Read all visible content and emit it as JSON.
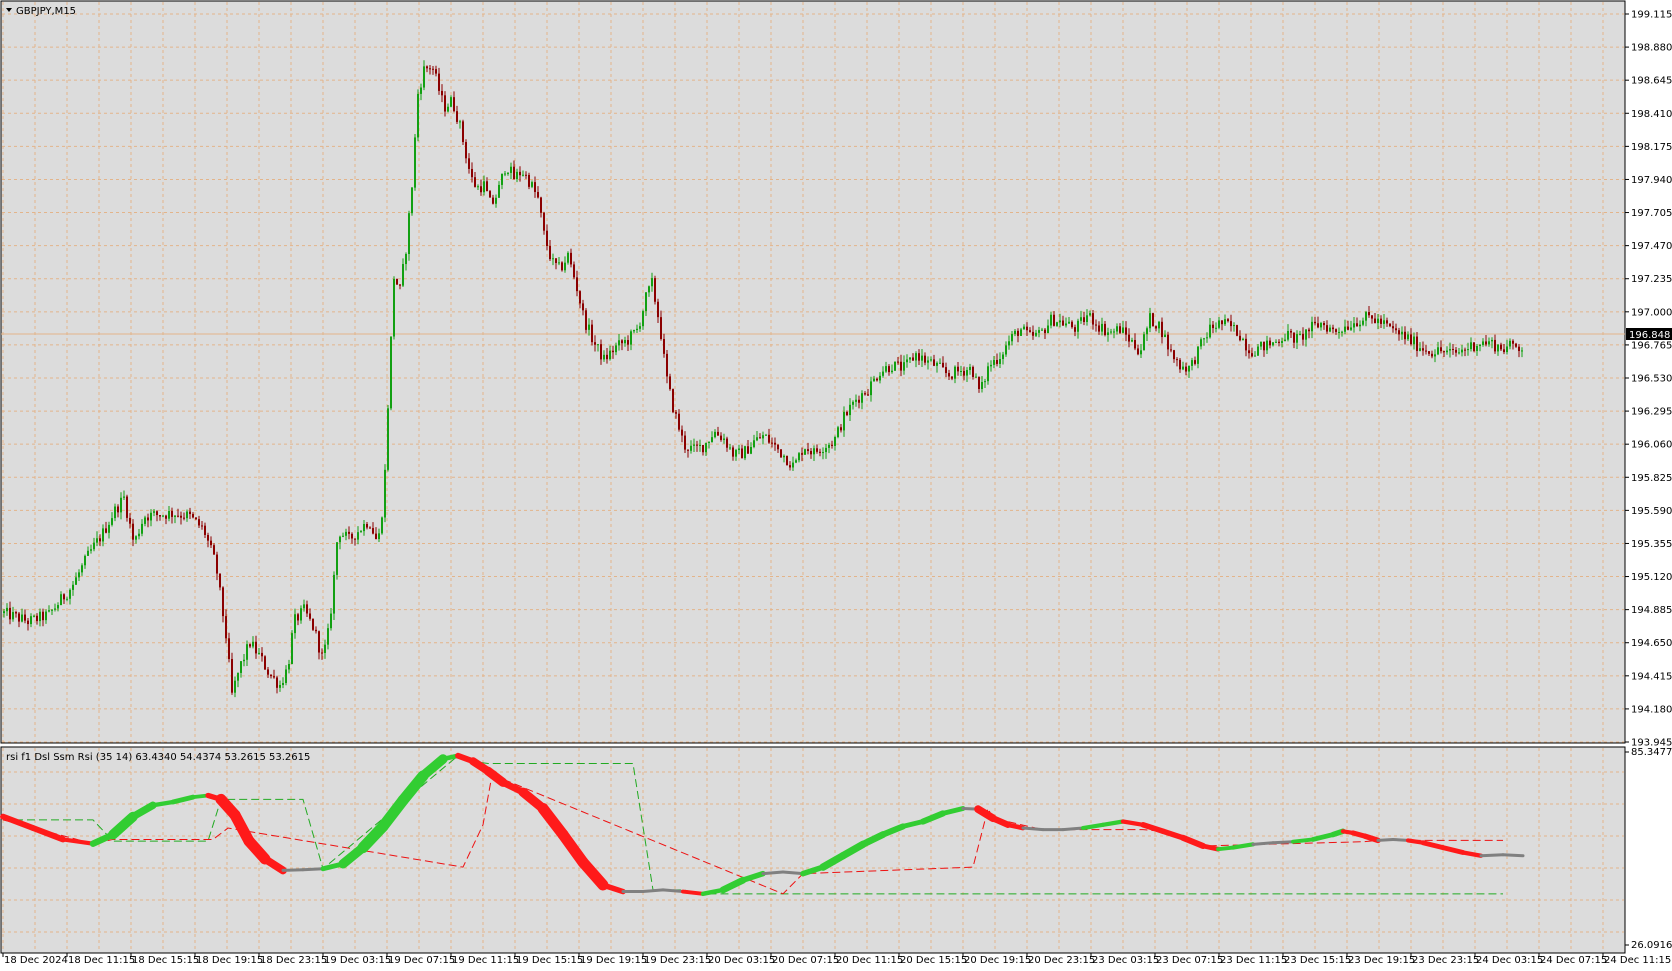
{
  "main": {
    "title": "GBPJPY,M15",
    "current_price": "196.848",
    "price_labels": [
      "199.115",
      "198.880",
      "198.645",
      "198.410",
      "198.175",
      "197.940",
      "197.705",
      "197.470",
      "197.235",
      "197.000",
      "196.765",
      "196.530",
      "196.295",
      "196.060",
      "195.825",
      "195.590",
      "195.355",
      "195.120",
      "194.885",
      "194.650",
      "194.415",
      "194.180",
      "193.945"
    ],
    "price_range": [
      193.945,
      199.115
    ],
    "current_value": 196.848
  },
  "indicator": {
    "title": "rsi f1 Dsl Ssm Rsi (35 14) 63.4340 54.4374 53.2615 53.2615",
    "top_label": "85.3477",
    "bottom_label": "26.0916",
    "range": [
      26.0916,
      85.3477
    ]
  },
  "time_labels": [
    "18 Dec 2024",
    "18 Dec 11:15",
    "18 Dec 15:15",
    "18 Dec 19:15",
    "18 Dec 23:15",
    "19 Dec 03:15",
    "19 Dec 07:15",
    "19 Dec 11:15",
    "19 Dec 15:15",
    "19 Dec 19:15",
    "19 Dec 23:15",
    "20 Dec 03:15",
    "20 Dec 07:15",
    "20 Dec 11:15",
    "20 Dec 15:15",
    "20 Dec 19:15",
    "20 Dec 23:15",
    "23 Dec 03:15",
    "23 Dec 07:15",
    "23 Dec 11:15",
    "23 Dec 15:15",
    "23 Dec 19:15",
    "23 Dec 23:15",
    "24 Dec 03:15",
    "24 Dec 07:15",
    "24 Dec 11:15"
  ],
  "colors": {
    "background": "#dcdcdc",
    "grid": "#e3b48a",
    "bull": "#12a012",
    "bear": "#8b0000",
    "rsi_up": "#32cd32",
    "rsi_down": "#ff1a1a",
    "rsi_flat": "#808080"
  },
  "chart_data": [
    {
      "type": "candlestick",
      "symbol": "GBPJPY",
      "timeframe": "M15",
      "ylim": [
        193.945,
        199.115
      ],
      "close_path": [
        [
          0,
          194.86
        ],
        [
          25,
          194.8
        ],
        [
          45,
          194.85
        ],
        [
          68,
          195.05
        ],
        [
          85,
          195.28
        ],
        [
          100,
          195.44
        ],
        [
          110,
          195.58
        ],
        [
          120,
          195.68
        ],
        [
          130,
          195.35
        ],
        [
          140,
          195.55
        ],
        [
          155,
          195.56
        ],
        [
          170,
          195.57
        ],
        [
          185,
          195.55
        ],
        [
          200,
          195.45
        ],
        [
          212,
          195.2
        ],
        [
          222,
          194.7
        ],
        [
          228,
          194.28
        ],
        [
          236,
          194.48
        ],
        [
          246,
          194.65
        ],
        [
          256,
          194.55
        ],
        [
          266,
          194.42
        ],
        [
          276,
          194.35
        ],
        [
          284,
          194.48
        ],
        [
          290,
          194.8
        ],
        [
          300,
          194.88
        ],
        [
          310,
          194.75
        ],
        [
          318,
          194.55
        ],
        [
          323,
          194.65
        ],
        [
          328,
          194.95
        ],
        [
          334,
          195.45
        ],
        [
          345,
          195.38
        ],
        [
          355,
          195.45
        ],
        [
          365,
          195.52
        ],
        [
          374,
          195.35
        ],
        [
          380,
          195.7
        ],
        [
          385,
          196.5
        ],
        [
          390,
          197.25
        ],
        [
          396,
          197.15
        ],
        [
          402,
          197.45
        ],
        [
          408,
          197.9
        ],
        [
          414,
          198.55
        ],
        [
          420,
          198.72
        ],
        [
          428,
          198.75
        ],
        [
          434,
          198.6
        ],
        [
          440,
          198.45
        ],
        [
          448,
          198.5
        ],
        [
          455,
          198.35
        ],
        [
          461,
          198.15
        ],
        [
          467,
          197.95
        ],
        [
          473,
          197.88
        ],
        [
          480,
          197.9
        ],
        [
          487,
          197.75
        ],
        [
          494,
          197.85
        ],
        [
          502,
          198.05
        ],
        [
          510,
          197.95
        ],
        [
          518,
          198.0
        ],
        [
          526,
          197.92
        ],
        [
          534,
          197.8
        ],
        [
          540,
          197.55
        ],
        [
          548,
          197.35
        ],
        [
          556,
          197.3
        ],
        [
          564,
          197.4
        ],
        [
          572,
          197.2
        ],
        [
          580,
          196.95
        ],
        [
          590,
          196.78
        ],
        [
          600,
          196.66
        ],
        [
          612,
          196.75
        ],
        [
          624,
          196.8
        ],
        [
          634,
          196.88
        ],
        [
          642,
          197.1
        ],
        [
          648,
          197.2
        ],
        [
          656,
          196.9
        ],
        [
          662,
          196.55
        ],
        [
          668,
          196.35
        ],
        [
          674,
          196.2
        ],
        [
          680,
          196.05
        ],
        [
          690,
          196.02
        ],
        [
          700,
          196.05
        ],
        [
          710,
          196.15
        ],
        [
          720,
          196.1
        ],
        [
          730,
          195.98
        ],
        [
          740,
          196.0
        ],
        [
          750,
          196.08
        ],
        [
          760,
          196.12
        ],
        [
          770,
          196.05
        ],
        [
          780,
          195.98
        ],
        [
          790,
          195.9
        ],
        [
          800,
          196.05
        ],
        [
          810,
          196.0
        ],
        [
          820,
          196.05
        ],
        [
          830,
          196.08
        ],
        [
          840,
          196.25
        ],
        [
          852,
          196.38
        ],
        [
          864,
          196.45
        ],
        [
          876,
          196.58
        ],
        [
          888,
          196.62
        ],
        [
          900,
          196.6
        ],
        [
          912,
          196.7
        ],
        [
          922,
          196.65
        ],
        [
          932,
          196.62
        ],
        [
          944,
          196.55
        ],
        [
          956,
          196.58
        ],
        [
          968,
          196.6
        ],
        [
          976,
          196.42
        ],
        [
          985,
          196.62
        ],
        [
          995,
          196.68
        ],
        [
          1006,
          196.8
        ],
        [
          1016,
          196.88
        ],
        [
          1026,
          196.82
        ],
        [
          1036,
          196.84
        ],
        [
          1048,
          196.95
        ],
        [
          1060,
          196.92
        ],
        [
          1072,
          196.88
        ],
        [
          1084,
          196.98
        ],
        [
          1095,
          196.9
        ],
        [
          1106,
          196.85
        ],
        [
          1116,
          196.88
        ],
        [
          1126,
          196.8
        ],
        [
          1136,
          196.72
        ],
        [
          1146,
          196.95
        ],
        [
          1156,
          196.9
        ],
        [
          1166,
          196.72
        ],
        [
          1176,
          196.62
        ],
        [
          1186,
          196.6
        ],
        [
          1196,
          196.75
        ],
        [
          1206,
          196.88
        ],
        [
          1216,
          196.92
        ],
        [
          1226,
          196.9
        ],
        [
          1236,
          196.84
        ],
        [
          1246,
          196.72
        ],
        [
          1258,
          196.75
        ],
        [
          1270,
          196.78
        ],
        [
          1282,
          196.84
        ],
        [
          1294,
          196.8
        ],
        [
          1306,
          196.88
        ],
        [
          1318,
          196.92
        ],
        [
          1330,
          196.86
        ],
        [
          1342,
          196.9
        ],
        [
          1354,
          196.94
        ],
        [
          1366,
          196.96
        ],
        [
          1378,
          196.92
        ],
        [
          1390,
          196.86
        ],
        [
          1402,
          196.82
        ],
        [
          1414,
          196.76
        ],
        [
          1426,
          196.72
        ],
        [
          1438,
          196.72
        ],
        [
          1450,
          196.7
        ],
        [
          1462,
          196.74
        ],
        [
          1474,
          196.78
        ],
        [
          1486,
          196.78
        ],
        [
          1498,
          196.74
        ],
        [
          1510,
          196.76
        ],
        [
          1520,
          196.75
        ]
      ]
    },
    {
      "type": "line",
      "title": "rsi f1 Dsl Ssm Rsi (35 14)",
      "ylim": [
        26.0916,
        85.3477
      ],
      "series": [
        {
          "points": [
            [
              0,
              65.5
            ],
            [
              30,
              62.0
            ],
            [
              60,
              58.5
            ],
            [
              90,
              57.2
            ],
            [
              110,
              60.0
            ],
            [
              130,
              65.5
            ],
            [
              150,
              69.0
            ],
            [
              170,
              70.0
            ],
            [
              190,
              71.5
            ],
            [
              205,
              72.0
            ],
            [
              218,
              70.8
            ],
            [
              232,
              66.0
            ],
            [
              246,
              58.0
            ],
            [
              262,
              52.5
            ],
            [
              280,
              49.0
            ],
            [
              300,
              49.2
            ],
            [
              320,
              49.5
            ],
            [
              340,
              51.0
            ],
            [
              360,
              56.0
            ],
            [
              380,
              62.5
            ],
            [
              400,
              70.5
            ],
            [
              420,
              78.0
            ],
            [
              440,
              83.2
            ],
            [
              455,
              84.2
            ],
            [
              470,
              82.5
            ],
            [
              485,
              79.5
            ],
            [
              500,
              76.0
            ],
            [
              520,
              73.0
            ],
            [
              540,
              68.0
            ],
            [
              560,
              60.0
            ],
            [
              580,
              51.5
            ],
            [
              600,
              44.5
            ],
            [
              620,
              42.5
            ],
            [
              640,
              42.5
            ],
            [
              660,
              43.0
            ],
            [
              680,
              42.5
            ],
            [
              700,
              41.8
            ],
            [
              720,
              43.0
            ],
            [
              740,
              46.0
            ],
            [
              760,
              48.0
            ],
            [
              780,
              48.5
            ],
            [
              800,
              48.0
            ],
            [
              820,
              50.0
            ],
            [
              840,
              53.5
            ],
            [
              860,
              57.0
            ],
            [
              880,
              60.0
            ],
            [
              900,
              62.5
            ],
            [
              920,
              64.0
            ],
            [
              940,
              66.5
            ],
            [
              960,
              68.0
            ],
            [
              975,
              67.8
            ],
            [
              990,
              65.0
            ],
            [
              1005,
              63.0
            ],
            [
              1020,
              62.0
            ],
            [
              1040,
              61.5
            ],
            [
              1060,
              61.5
            ],
            [
              1080,
              62.0
            ],
            [
              1100,
              63.0
            ],
            [
              1120,
              64.0
            ],
            [
              1140,
              63.0
            ],
            [
              1160,
              61.0
            ],
            [
              1180,
              59.0
            ],
            [
              1200,
              56.5
            ],
            [
              1215,
              55.5
            ],
            [
              1230,
              56.0
            ],
            [
              1250,
              57.0
            ],
            [
              1270,
              57.5
            ],
            [
              1290,
              57.8
            ],
            [
              1310,
              58.5
            ],
            [
              1330,
              60.0
            ],
            [
              1340,
              61.0
            ],
            [
              1350,
              60.5
            ],
            [
              1362,
              59.5
            ],
            [
              1375,
              58.2
            ],
            [
              1390,
              58.5
            ],
            [
              1405,
              58.2
            ],
            [
              1420,
              57.5
            ],
            [
              1440,
              56.0
            ],
            [
              1460,
              54.5
            ],
            [
              1478,
              53.5
            ],
            [
              1500,
              53.8
            ],
            [
              1520,
              53.5
            ]
          ]
        },
        {
          "points": [
            [
              0,
              64.5
            ],
            [
              90,
              64.5
            ],
            [
              110,
              58.0
            ],
            [
              205,
              58.0
            ],
            [
              218,
              70.8
            ],
            [
              300,
              70.8
            ],
            [
              320,
              49.5
            ],
            [
              455,
              84.2
            ],
            [
              470,
              82.5
            ],
            [
              485,
              81.8
            ],
            [
              630,
              81.8
            ],
            [
              650,
              43.0
            ],
            [
              680,
              43.0
            ],
            [
              700,
              41.8
            ],
            [
              1500,
              41.8
            ]
          ]
        },
        {
          "points": [
            [
              0,
              64.5
            ],
            [
              90,
              57.2
            ],
            [
              110,
              58.5
            ],
            [
              210,
              58.5
            ],
            [
              225,
              62.0
            ],
            [
              460,
              50.0
            ],
            [
              480,
              63.0
            ],
            [
              490,
              80.0
            ],
            [
              500,
              77.0
            ],
            [
              780,
              41.8
            ],
            [
              800,
              48.0
            ],
            [
              970,
              50.0
            ],
            [
              985,
              68.0
            ],
            [
              990,
              65.0
            ],
            [
              1040,
              61.5
            ],
            [
              1140,
              61.5
            ],
            [
              1160,
              61.0
            ],
            [
              1200,
              56.5
            ],
            [
              1360,
              57.8
            ],
            [
              1375,
              58.2
            ],
            [
              1500,
              58.2
            ]
          ]
        }
      ]
    }
  ]
}
